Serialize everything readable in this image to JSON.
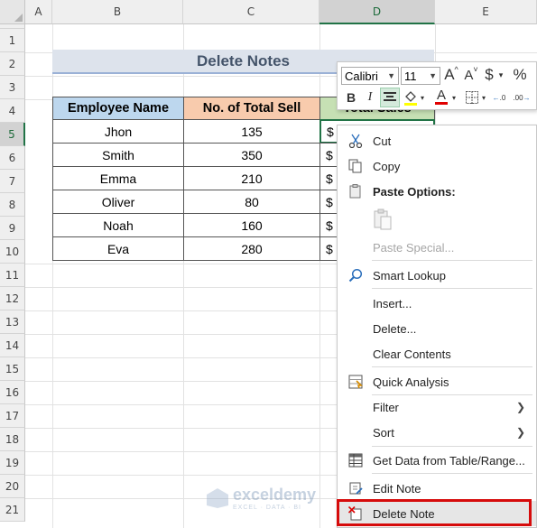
{
  "columns": [
    "A",
    "B",
    "C",
    "D",
    "E"
  ],
  "rows": [
    "1",
    "2",
    "3",
    "4",
    "5",
    "6",
    "7",
    "8",
    "9",
    "10",
    "11",
    "12",
    "13",
    "14",
    "15",
    "16",
    "17",
    "18",
    "19",
    "20",
    "21"
  ],
  "title": "Delete Notes",
  "table": {
    "headers": [
      "Employee Name",
      "No. of Total Sell",
      "Total Sales"
    ],
    "rows": [
      {
        "name": "Jhon",
        "sell": "135",
        "sales": "$"
      },
      {
        "name": "Smith",
        "sell": "350",
        "sales": "$"
      },
      {
        "name": "Emma",
        "sell": "210",
        "sales": "$"
      },
      {
        "name": "Oliver",
        "sell": "80",
        "sales": "$"
      },
      {
        "name": "Noah",
        "sell": "160",
        "sales": "$"
      },
      {
        "name": "Eva",
        "sell": "280",
        "sales": "$"
      }
    ]
  },
  "mini_toolbar": {
    "font": "Calibri",
    "size": "11",
    "grow_font": "A",
    "shrink_font": "A",
    "currency": "$",
    "percent": "%",
    "bold": "B",
    "italic": "I"
  },
  "context_menu": {
    "cut": "Cut",
    "copy": "Copy",
    "paste_options": "Paste Options:",
    "paste_special": "Paste Special...",
    "smart_lookup": "Smart Lookup",
    "insert": "Insert...",
    "delete": "Delete...",
    "clear_contents": "Clear Contents",
    "quick_analysis": "Quick Analysis",
    "filter": "Filter",
    "sort": "Sort",
    "get_data": "Get Data from Table/Range...",
    "edit_note": "Edit Note",
    "delete_note": "Delete Note"
  },
  "watermark": {
    "brand": "exceldemy",
    "tagline": "EXCEL · DATA · BI"
  },
  "colors": {
    "accent": "#217346",
    "highlight": "#d60b0b"
  }
}
